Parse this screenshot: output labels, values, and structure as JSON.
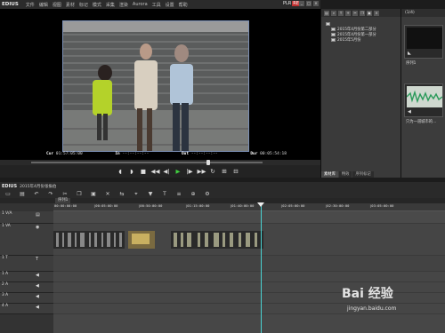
{
  "app": {
    "title": "EDIUS"
  },
  "menu": {
    "items": [
      "文件",
      "编辑",
      "视图",
      "素材",
      "标记",
      "模式",
      "采集",
      "渲染",
      "Aurora",
      "工具",
      "设置",
      "帮助"
    ]
  },
  "mode": {
    "plr": "PLR",
    "rec": "REC"
  },
  "preview": {
    "cur_label": "Cur",
    "cur_value": "01:57:05:00",
    "in_label": "In",
    "in_value": "--:--:--:--",
    "out_label": "Out",
    "out_value": "--:--:--:--",
    "dur_label": "Dur",
    "dur_value": "00:05:54:18"
  },
  "bin": {
    "folders": [
      "2015年4月份第二部分",
      "2015年4月份第一部分",
      "2015年5月份"
    ],
    "tabs": [
      "素材库",
      "特效",
      "序列标记"
    ]
  },
  "clips": {
    "header": "(1/4)",
    "items": [
      {
        "name": "序列1"
      },
      {
        "name": "只为一道城市的..."
      }
    ]
  },
  "timeline": {
    "logo": "EDIUS",
    "project": "2015年4月份张振伯",
    "sequence_tab": "序列1",
    "ruler": [
      "00:00:00:00",
      "|00:05:00:00",
      "|00:50:00:00",
      "|01:15:00:00",
      "|01:40:00:00",
      "|02:05:00:00",
      "|02:30:00:00",
      "|03:05:00:00"
    ],
    "tracks": [
      {
        "label": "1 V/A"
      },
      {
        "label": "1 VA"
      },
      {
        "label": "1 T"
      },
      {
        "label": "1 A"
      },
      {
        "label": "2 A"
      },
      {
        "label": "3 A"
      },
      {
        "label": "4 A"
      }
    ]
  },
  "watermark": {
    "text": "Bai 经验",
    "url": "jingyan.baidu.com"
  },
  "colors": {
    "accent": "#4ad3d3",
    "rec": "#c03030",
    "play": "#40d040"
  }
}
